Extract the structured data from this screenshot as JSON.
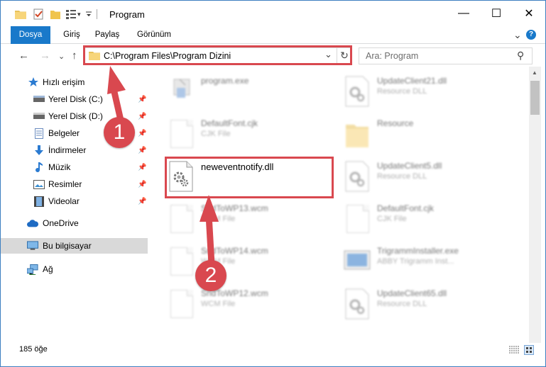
{
  "window": {
    "title": "Program",
    "minimize_glyph": "—",
    "maximize_glyph": "☐",
    "close_glyph": "✕"
  },
  "ribbon": {
    "tabs": [
      "Dosya",
      "Giriş",
      "Paylaş",
      "Görünüm"
    ],
    "expand_glyph": "⌄",
    "help_glyph": "?"
  },
  "nav": {
    "back_glyph": "←",
    "forward_glyph": "→",
    "recent_glyph": "⌄",
    "up_glyph": "↑",
    "address": "C:\\Program Files\\Program Dizini",
    "address_dropdown_glyph": "⌄",
    "refresh_glyph": "↻",
    "search_placeholder": "Ara: Program",
    "search_glyph": "⚲"
  },
  "sidebar": {
    "pin_glyph": "📌",
    "quick_access": "Hızlı erişim",
    "items": [
      {
        "label": "Yerel Disk (C:)",
        "icon": "drive-icon"
      },
      {
        "label": "Yerel Disk (D:)",
        "icon": "drive-icon"
      },
      {
        "label": "Belgeler",
        "icon": "documents-icon"
      },
      {
        "label": "İndirmeler",
        "icon": "downloads-icon"
      },
      {
        "label": "Müzik",
        "icon": "music-icon"
      },
      {
        "label": "Resimler",
        "icon": "pictures-icon"
      },
      {
        "label": "Videolar",
        "icon": "videos-icon"
      }
    ],
    "onedrive": "OneDrive",
    "this_pc": "Bu bilgisayar",
    "network": "Ağ"
  },
  "files": {
    "left": [
      {
        "name": "program.exe",
        "type": "",
        "kind": "exe"
      },
      {
        "name": "DefaultFont.cjk",
        "type": "CJK File",
        "kind": "doc"
      },
      {
        "name": "neweventnotify.dll",
        "type": "",
        "kind": "dll"
      },
      {
        "name": "SndToWP13.wcm",
        "type": "WCM File",
        "kind": "doc"
      },
      {
        "name": "SndToWP14.wcm",
        "type": "WCM File",
        "kind": "doc"
      },
      {
        "name": "SndToWP12.wcm",
        "type": "WCM File",
        "kind": "doc"
      }
    ],
    "right": [
      {
        "name": "UpdateClient21.dll",
        "type": "Resource DLL",
        "kind": "dll"
      },
      {
        "name": "Resource",
        "type": "",
        "kind": "folder"
      },
      {
        "name": "UpdateClient5.dll",
        "type": "Resource DLL",
        "kind": "dll"
      },
      {
        "name": "DefaultFont.cjk",
        "type": "CJK File",
        "kind": "doc"
      },
      {
        "name": "TrigrammInstaller.exe",
        "type": "ABBY Trigramm Inst...",
        "kind": "exe"
      },
      {
        "name": "UpdateClient65.dll",
        "type": "Resource DLL",
        "kind": "dll"
      }
    ]
  },
  "status": {
    "item_count": "185 öğe"
  },
  "annotations": {
    "step1": "1",
    "step2": "2",
    "accent": "#d9484f"
  },
  "colors": {
    "file_tab": "#1979ca",
    "selection": "#d9d9d9"
  }
}
